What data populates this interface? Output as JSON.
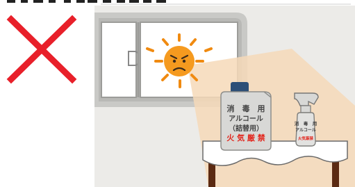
{
  "colors": {
    "cross": "#e8202a",
    "wall": "#ecebe8",
    "window_frame": "#c9c9c6",
    "window_glass": "#ffffff",
    "sun_face": "#f59a1f",
    "sun_rays": "#f08a10",
    "sunlight": "#f6d9b8",
    "bottle_body": "#d8d8d6",
    "bottle_cap": "#2d4f77",
    "warning_text": "#e2231a",
    "table_top": "#ffffff",
    "table_legs": "#5b2a12"
  },
  "icons": {
    "cross": "x-mark-icon",
    "sun": "angry-sun-icon"
  },
  "container": {
    "line1": "消　毒　用",
    "line2": "アルコール",
    "line3": "（詰替用）",
    "warning": "火 気 厳 禁"
  },
  "spray": {
    "line1": "消　毒　用",
    "line2": "アルコール",
    "warning": "火気厳禁"
  }
}
